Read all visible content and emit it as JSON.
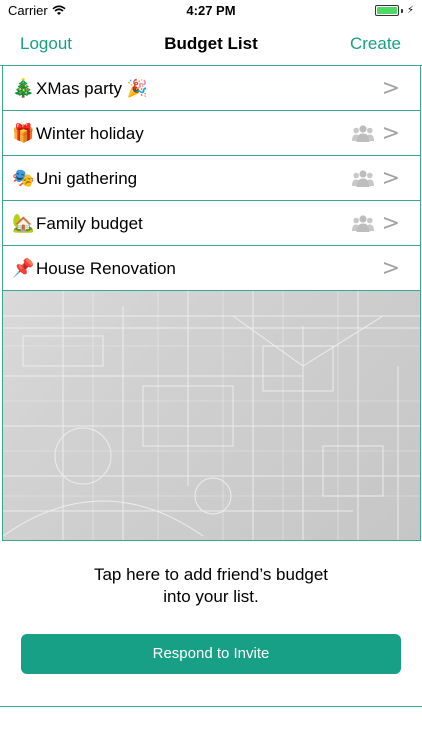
{
  "status_bar": {
    "carrier": "Carrier",
    "time": "4:27 PM",
    "wifi_icon": "wifi-icon",
    "battery_icon": "battery-icon"
  },
  "nav": {
    "left": "Logout",
    "title": "Budget List",
    "right": "Create"
  },
  "colors": {
    "accent": "#17a086",
    "divider": "#3aa891",
    "chevron": "#a3a3a3"
  },
  "budgets": [
    {
      "emoji": "🎄",
      "label": "XMas party 🎉",
      "shared": false,
      "chevron": ">"
    },
    {
      "emoji": "🎁",
      "label": "Winter holiday",
      "shared": true,
      "chevron": ">"
    },
    {
      "emoji": "🎭",
      "label": "Uni gathering",
      "shared": true,
      "chevron": ">"
    },
    {
      "emoji": "🏡",
      "label": " Family budget",
      "shared": true,
      "chevron": ">"
    },
    {
      "emoji": "📌",
      "label": "House Renovation",
      "shared": false,
      "chevron": ">"
    }
  ],
  "footer": {
    "hint_line1": "Tap here to add friend’s budget",
    "hint_line2": "into your list.",
    "button": "Respond to Invite"
  }
}
